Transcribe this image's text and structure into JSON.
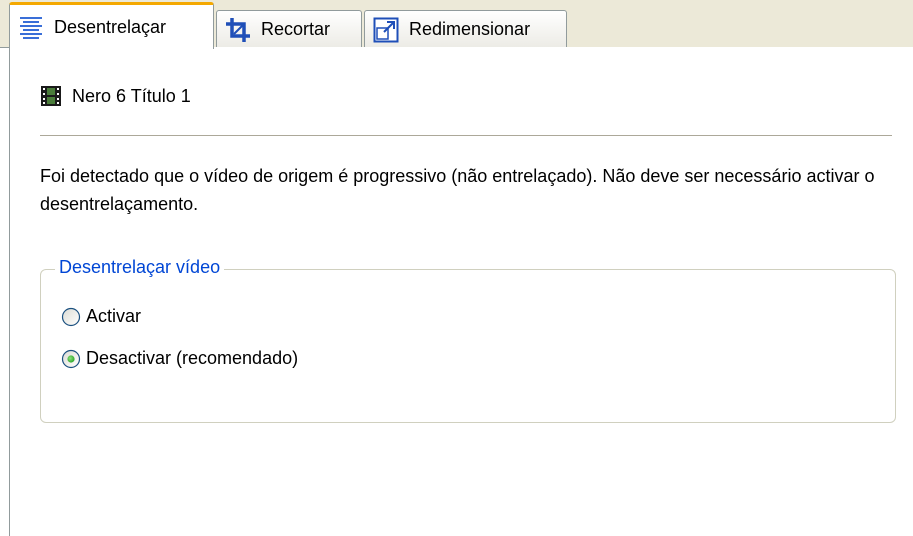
{
  "tabs": [
    {
      "label": "Desentrelaçar",
      "icon": "deinterlace-lines-icon",
      "active": true
    },
    {
      "label": "Recortar",
      "icon": "crop-icon",
      "active": false
    },
    {
      "label": "Redimensionar",
      "icon": "resize-icon",
      "active": false
    }
  ],
  "source": {
    "title": "Nero 6 Título 1",
    "icon": "film-strip-icon"
  },
  "info_text": "Foi detectado que o vídeo de origem é progressivo (não entrelaçado). Não deve ser necessário activar o desentrelaçamento.",
  "deinterlace_group": {
    "title": "Desentrelaçar vídeo",
    "options": [
      {
        "label": "Activar",
        "selected": false
      },
      {
        "label": "Desactivar (recomendado)",
        "selected": true
      }
    ]
  },
  "colors": {
    "active_tab_accent": "#f4a800",
    "groupbox_title": "#0046d5",
    "tabstrip_background": "#ece9d8"
  }
}
